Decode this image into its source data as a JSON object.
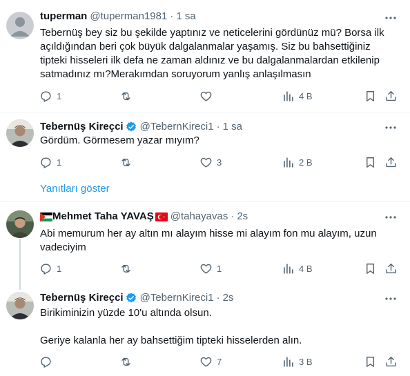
{
  "tweets": [
    {
      "name": "tuperman",
      "handle": "@tuperman1981",
      "dot": "·",
      "time": "1 sa",
      "text": "Tebernüş bey siz bu şekilde yaptınız ve neticelerini gördünüz mü? Borsa ilk açıldığından beri çok büyük dalgalanmalar yaşamış. Siz bu bahsettiğiniz tipteki hisseleri ilk defa ne zaman aldınız ve bu dalgalanmalardan etkilenip satmadınız mı?Merakımdan soruyorum yanlış anlaşılmasın",
      "replies": "1",
      "retweets": "",
      "likes": "",
      "views": "4 B"
    },
    {
      "name": "Tebernüş Kireçci",
      "handle": "@TebernKireci1",
      "dot": "·",
      "time": "1 sa",
      "text": "Gördüm. Görmesem yazar mıyım?",
      "replies": "1",
      "retweets": "",
      "likes": "3",
      "views": "2 B"
    },
    {
      "name": "Mehmet Taha YAVAŞ",
      "handle": "@tahayavas",
      "dot": "·",
      "time": "2s",
      "text": "Abi memurum her ay altın mı alayım hisse mi alayım fon mu alayım, uzun vadeciyim",
      "replies": "1",
      "retweets": "",
      "likes": "1",
      "views": "4 B"
    },
    {
      "name": "Tebernüş Kireçci",
      "handle": "@TebernKireci1",
      "dot": "·",
      "time": "2s",
      "text": "Birikiminizin yüzde 10'u altında olsun.\n\nGeriye kalanla her ay bahsettiğim tipteki hisselerden alın.",
      "replies": "",
      "retweets": "",
      "likes": "7",
      "views": "3 B"
    }
  ],
  "show_replies": "Yanıtları göster",
  "colors": {
    "accent": "#1d9bf0",
    "muted": "#536471",
    "text": "#0f1419"
  }
}
